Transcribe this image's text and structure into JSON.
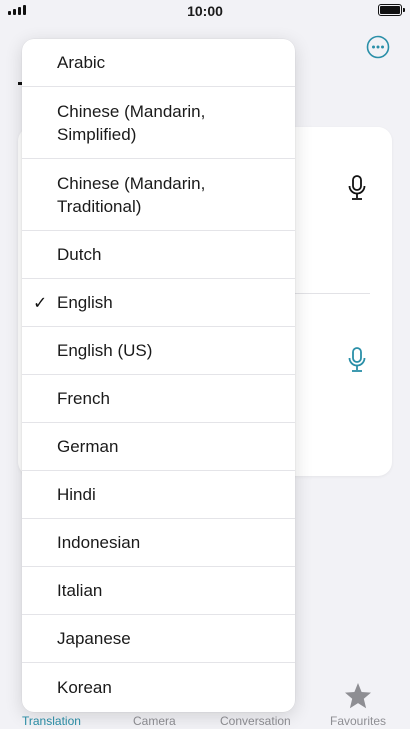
{
  "status_bar": {
    "time": "10:00"
  },
  "language_menu": {
    "items": [
      {
        "label": "Arabic",
        "selected": false
      },
      {
        "label": "Chinese (Mandarin, Simplified)",
        "selected": false
      },
      {
        "label": "Chinese (Mandarin, Traditional)",
        "selected": false
      },
      {
        "label": "Dutch",
        "selected": false
      },
      {
        "label": "English",
        "selected": true
      },
      {
        "label": "English (US)",
        "selected": false
      },
      {
        "label": "French",
        "selected": false
      },
      {
        "label": "German",
        "selected": false
      },
      {
        "label": "Hindi",
        "selected": false
      },
      {
        "label": "Indonesian",
        "selected": false
      },
      {
        "label": "Italian",
        "selected": false
      },
      {
        "label": "Japanese",
        "selected": false
      },
      {
        "label": "Korean",
        "selected": false
      }
    ],
    "checkmark": "✓"
  },
  "tabs": {
    "translation": "Translation",
    "camera": "Camera",
    "conversation": "Conversation",
    "favourites": "Favourites"
  },
  "icons": {
    "more": "more-icon",
    "mic": "microphone-icon",
    "favourites": "star-icon",
    "check": "checkmark-icon"
  },
  "colors": {
    "accent": "#2a8fa8",
    "inactive": "#8e8e93"
  }
}
